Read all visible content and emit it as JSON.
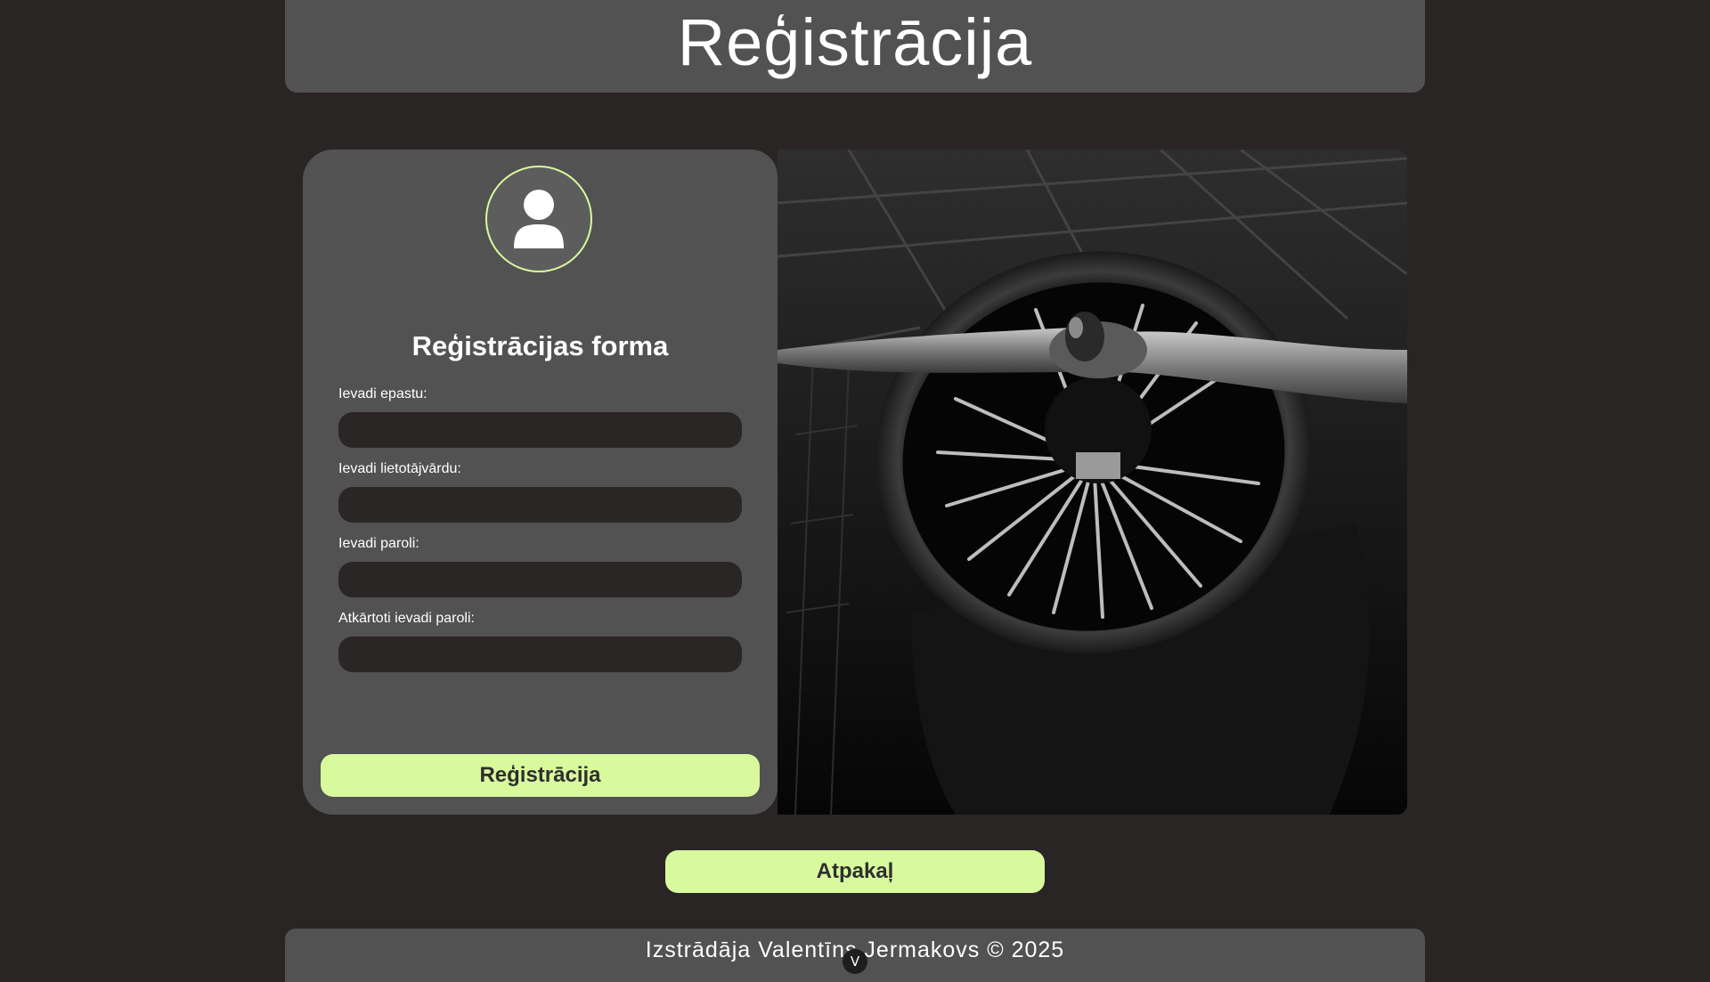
{
  "header": {
    "title": "Reģistrācija"
  },
  "form": {
    "avatar_icon": "user-icon",
    "title": "Reģistrācijas forma",
    "fields": [
      {
        "label": "Ievadi epastu:",
        "value": "",
        "placeholder": ""
      },
      {
        "label": "Ievadi lietotājvārdu:",
        "value": "",
        "placeholder": ""
      },
      {
        "label": "Ievadi paroli:",
        "value": "",
        "placeholder": ""
      },
      {
        "label": "Atkārtoti ievadi paroli:",
        "value": "",
        "placeholder": ""
      }
    ],
    "submit_label": "Reģistrācija"
  },
  "back_button": {
    "label": "Atpakaļ"
  },
  "footer": {
    "text": "Izstrādāja Valentīns Jermakovs © 2025",
    "scroll_label": "V"
  },
  "colors": {
    "background": "#2a2525",
    "panel": "#525252",
    "accent": "#d9f99d",
    "input": "#2a2626"
  }
}
